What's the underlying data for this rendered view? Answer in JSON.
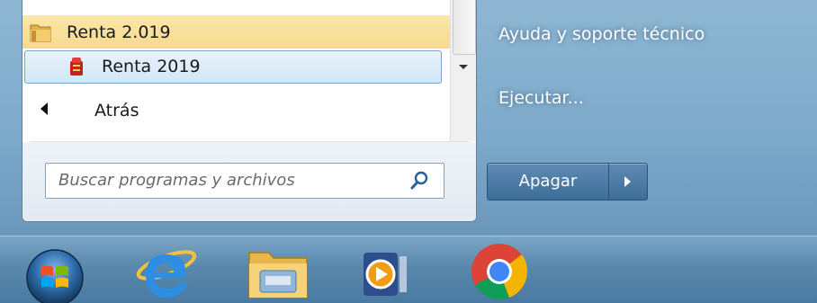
{
  "start_menu": {
    "programs": {
      "folder": {
        "label": "Renta 2.019",
        "icon": "folder-icon"
      },
      "item": {
        "label": "Renta 2019",
        "icon": "renta-app-icon"
      }
    },
    "back": {
      "label": "Atrás"
    },
    "search": {
      "placeholder": "Buscar programas y archivos"
    },
    "right_pane": {
      "help": "Ayuda y soporte técnico",
      "run": "Ejecutar..."
    },
    "shutdown": {
      "label": "Apagar"
    }
  },
  "taskbar": {
    "items": [
      {
        "name": "start-orb-icon"
      },
      {
        "name": "internet-explorer-icon"
      },
      {
        "name": "file-explorer-icon"
      },
      {
        "name": "media-player-icon"
      },
      {
        "name": "chrome-icon"
      }
    ]
  },
  "colors": {
    "selected_folder_bg": "#f9dd97",
    "selected_item_border": "#7da2ce",
    "shutdown_button": "#4a79a4",
    "taskbar": "#5a88ad"
  }
}
